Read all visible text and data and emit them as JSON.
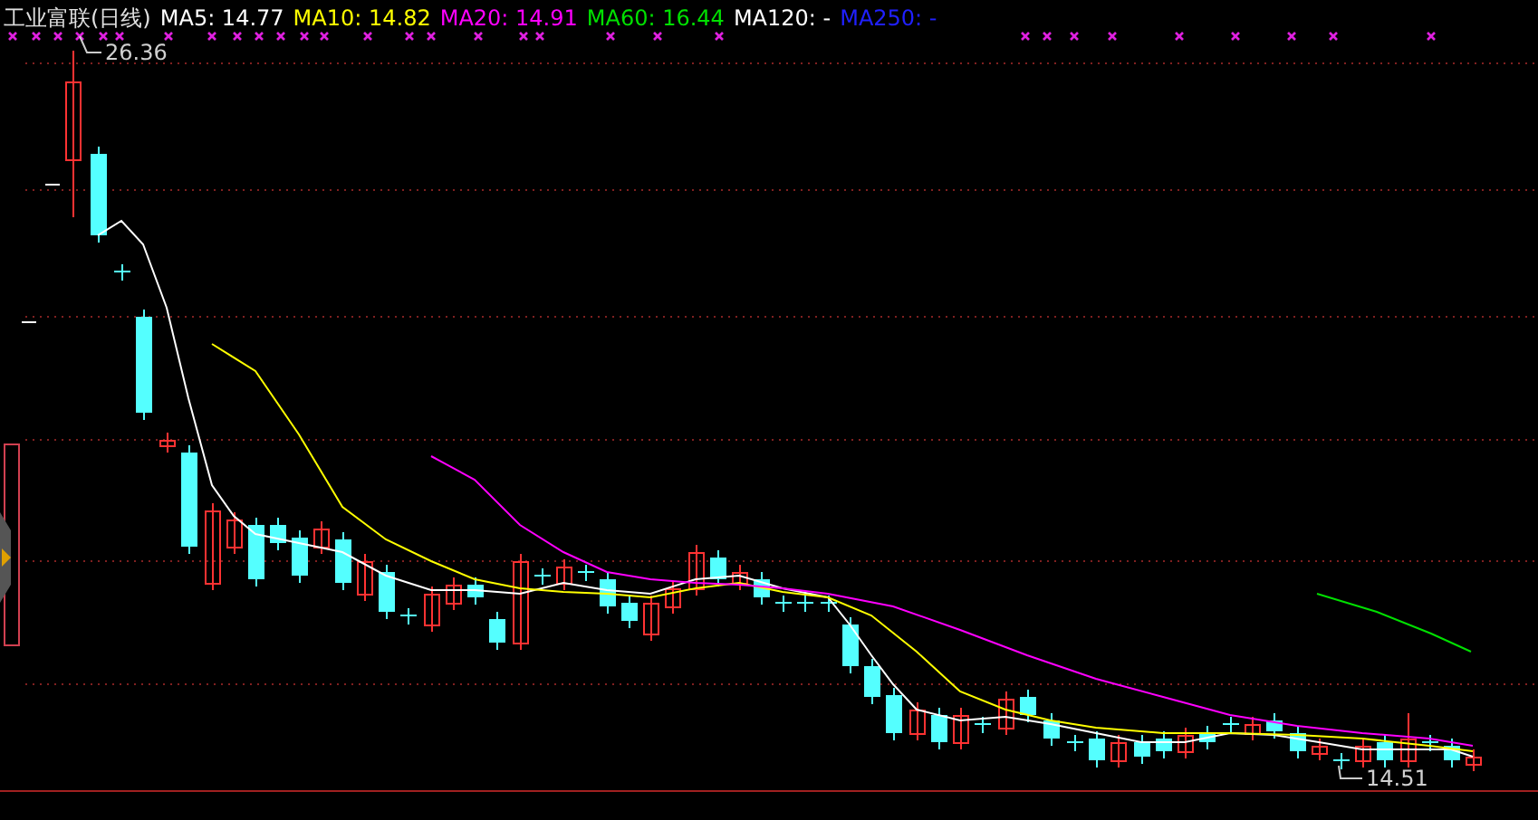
{
  "title": "工业富联(日线)",
  "indicators": [
    {
      "label": "MA5: 14.77",
      "color": "#ffffff"
    },
    {
      "label": "MA10: 14.82",
      "color": "#ffff00"
    },
    {
      "label": "MA20: 14.91",
      "color": "#ff00ff"
    },
    {
      "label": "MA60: 16.44",
      "color": "#00e000"
    },
    {
      "label": "MA120: -",
      "color": "#ffffff"
    },
    {
      "label": "MA250: -",
      "color": "#2020ff"
    }
  ],
  "price_labels": {
    "high": "26.36",
    "low": "14.51"
  }
}
